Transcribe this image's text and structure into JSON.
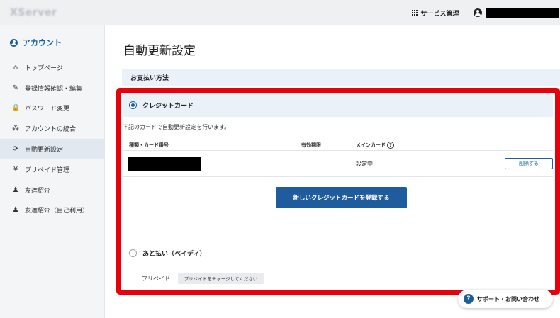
{
  "topbar": {
    "logo": "XServer",
    "services_label": "サービス管理",
    "icons": {
      "services": "grid-icon",
      "user": "user-circle-icon"
    }
  },
  "sidebar": {
    "heading": "アカウント",
    "items": [
      {
        "label": "トップページ",
        "icon": "home-icon",
        "glyph": "⌂"
      },
      {
        "label": "登録情報確認・編集",
        "icon": "edit-icon",
        "glyph": "✎"
      },
      {
        "label": "パスワード変更",
        "icon": "lock-icon",
        "glyph": "🔒"
      },
      {
        "label": "アカウントの統合",
        "icon": "merge-icon",
        "glyph": "⁂"
      },
      {
        "label": "自動更新設定",
        "icon": "refresh-icon",
        "glyph": "⟳",
        "active": true
      },
      {
        "label": "プリペイド管理",
        "icon": "yen-icon",
        "glyph": "¥"
      },
      {
        "label": "友達紹介",
        "icon": "person-icon",
        "glyph": "♟"
      },
      {
        "label": "友達紹介（自己利用）",
        "icon": "person-arrow-icon",
        "glyph": "♟"
      }
    ]
  },
  "main": {
    "title": "自動更新設定",
    "section": "お支払い方法",
    "credit_card": {
      "label": "クレジットカード",
      "description": "下記のカードで自動更新設定を行います。",
      "columns": {
        "type": "種類・カード番号",
        "expiry": "有効期限",
        "main": "メインカード"
      },
      "row": {
        "main_status": "設定中",
        "delete_label": "削除する"
      },
      "register_label": "新しいクレジットカードを登録する"
    },
    "deferred": {
      "label": "あと払い（ペイディ）"
    },
    "prepaid": {
      "label": "プリペイド",
      "button": "プリペイドをチャージしてください"
    },
    "support_label": "サポート・お問い合わせ"
  },
  "colors": {
    "accent": "#1a5fa8",
    "highlight": "#e8000b",
    "button": "#1f5c9e"
  }
}
